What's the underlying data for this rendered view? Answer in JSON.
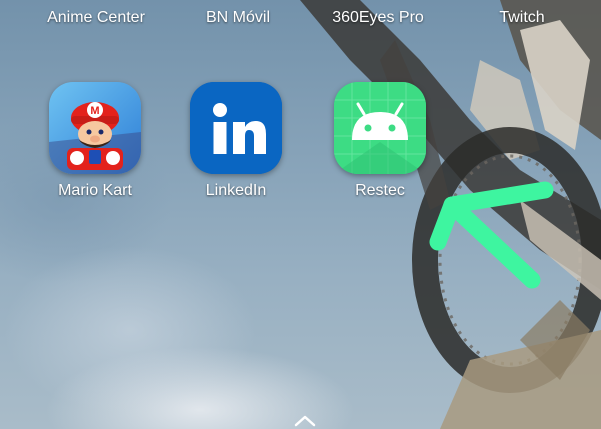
{
  "top_row": [
    {
      "label": "Anime Center"
    },
    {
      "label": "BN Móvil"
    },
    {
      "label": "360Eyes Pro"
    },
    {
      "label": "Twitch"
    }
  ],
  "apps": [
    {
      "label": "Mario Kart",
      "icon": "mario-kart-icon"
    },
    {
      "label": "LinkedIn",
      "icon": "linkedin-icon",
      "icon_text": "in"
    },
    {
      "label": "Restec",
      "icon": "android-icon"
    }
  ],
  "colors": {
    "linkedin_blue": "#0a66c2",
    "android_green": "#3ddc84",
    "annotation_arrow": "#3ef5a0"
  }
}
